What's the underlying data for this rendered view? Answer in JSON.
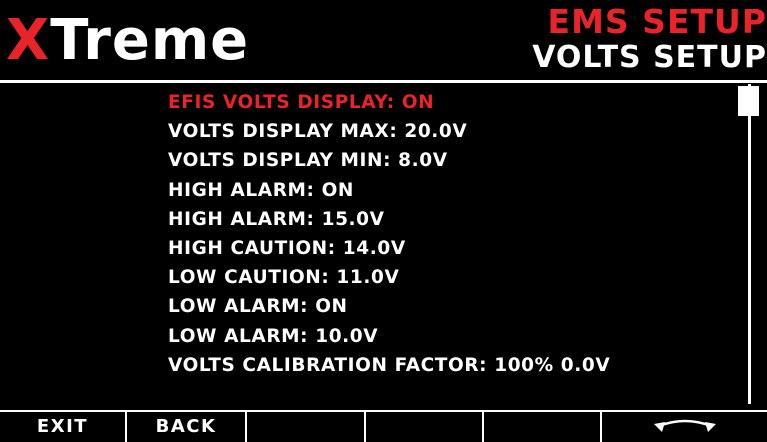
{
  "brand": {
    "logo_accent": "X",
    "logo_rest": "Treme",
    "accent_color": "#e8232a"
  },
  "header": {
    "title": "EMS SETUP",
    "subtitle": "VOLTS SETUP"
  },
  "menu": {
    "selected_index": 0,
    "items": [
      {
        "label": "EFIS VOLTS DISPLAY: ON"
      },
      {
        "label": "VOLTS DISPLAY MAX: 20.0V"
      },
      {
        "label": "VOLTS DISPLAY MIN: 8.0V"
      },
      {
        "label": "HIGH ALARM: ON"
      },
      {
        "label": "HIGH ALARM: 15.0V"
      },
      {
        "label": "HIGH CAUTION: 14.0V"
      },
      {
        "label": "LOW CAUTION: 11.0V"
      },
      {
        "label": "LOW ALARM: ON"
      },
      {
        "label": "LOW ALARM: 10.0V"
      },
      {
        "label": "VOLTS CALIBRATION FACTOR: 100% 0.0V"
      }
    ]
  },
  "softkeys": {
    "key1": "EXIT",
    "key2": "BACK",
    "key3": "",
    "key4": "",
    "key5": "",
    "key6_icon": "rotary-knob-icon"
  }
}
